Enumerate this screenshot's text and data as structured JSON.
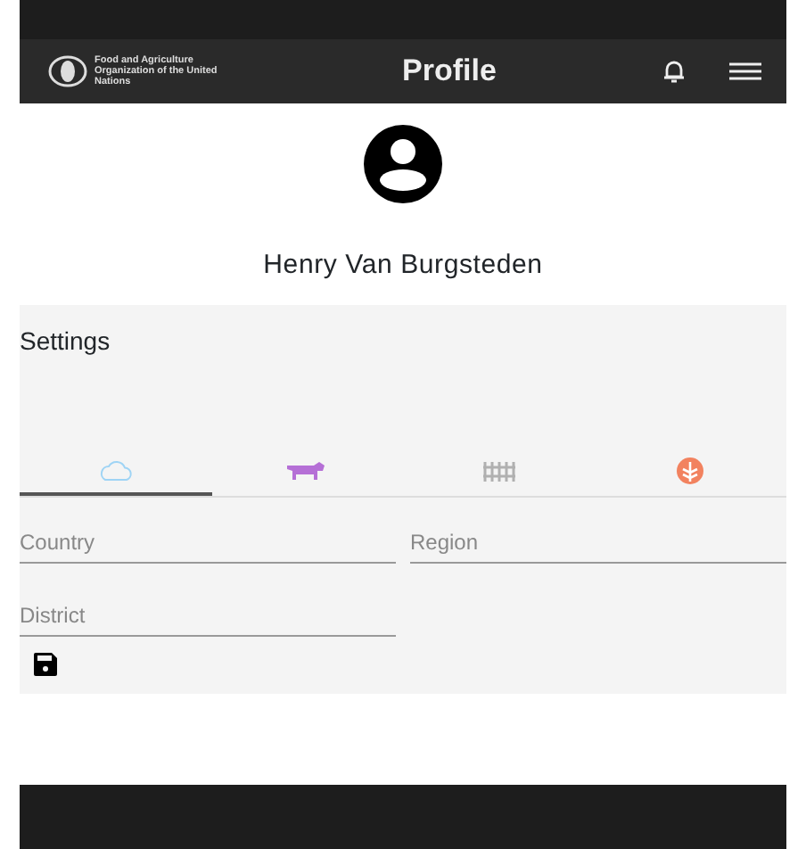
{
  "header": {
    "org_name": "Food and Agriculture Organization of the United Nations",
    "title": "Profile"
  },
  "user": {
    "name": "Henry Van Burgsteden"
  },
  "settings": {
    "title": "Settings",
    "tabs": [
      {
        "kind": "cloud",
        "color": "#9fd4f5",
        "selected": true
      },
      {
        "kind": "cow",
        "color": "#b56fd6",
        "selected": false
      },
      {
        "kind": "fence",
        "color": "#b0b0b0",
        "selected": false
      },
      {
        "kind": "wheat",
        "color": "#f2825f",
        "selected": false
      }
    ],
    "fields": [
      {
        "placeholder": "Country"
      },
      {
        "placeholder": "Region"
      },
      {
        "placeholder": "District"
      }
    ]
  }
}
